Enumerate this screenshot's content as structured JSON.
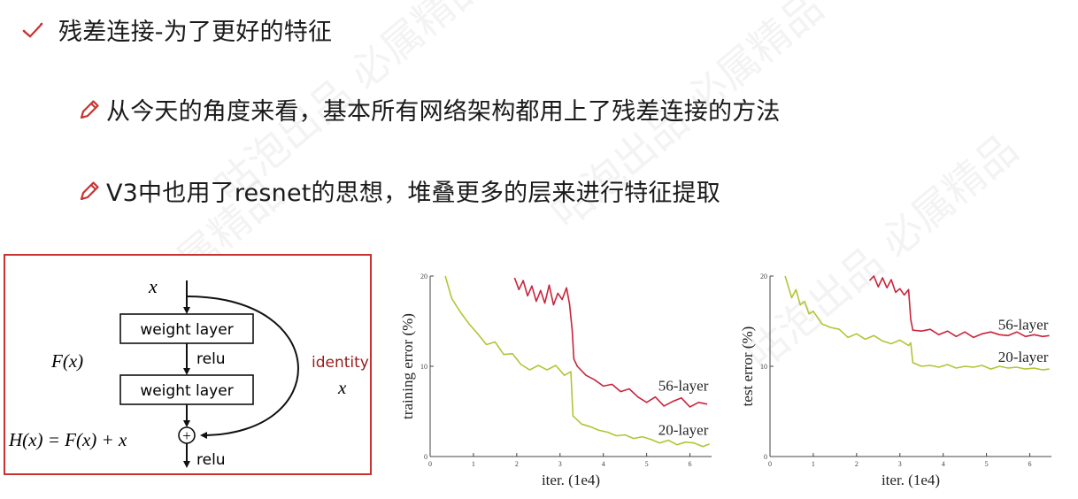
{
  "heading": {
    "text": "残差连接-为了更好的特征"
  },
  "bullets": [
    {
      "text": "从今天的角度来看，基本所有网络架构都用上了残差连接的方法"
    },
    {
      "text": "V3中也用了resnet的思想，堆叠更多的层来进行特征提取"
    }
  ],
  "watermark": {
    "text": "咕泡出品 必属精品"
  },
  "res_block": {
    "input_label": "x",
    "layer1": "weight layer",
    "relu_mid": "relu",
    "layer2": "weight layer",
    "fx_label": "F(x)",
    "identity_label": "identity",
    "identity_x": "x",
    "hx_label": "H(x) = F(x) + x",
    "plus": "+",
    "relu_out": "relu"
  },
  "colors": {
    "accent": "#c8332f",
    "red_line": "#c9243b",
    "green_line": "#b4c436",
    "identity": "#9a1a1a"
  },
  "chart_data": [
    {
      "type": "line",
      "xlabel": "iter. (1e4)",
      "ylabel": "training error (%)",
      "xlim": [
        0,
        6.5
      ],
      "ylim": [
        0,
        20
      ],
      "xticks": [
        0,
        1,
        2,
        3,
        4,
        5,
        6
      ],
      "yticks": [
        0,
        10,
        20
      ],
      "series": [
        {
          "name": "56-layer",
          "x": [
            1.95,
            2.05,
            2.15,
            2.25,
            2.35,
            2.45,
            2.55,
            2.65,
            2.75,
            2.85,
            2.95,
            3.05,
            3.15,
            3.22,
            3.28,
            3.32,
            3.4,
            3.6,
            3.8,
            4.0,
            4.2,
            4.4,
            4.6,
            4.8,
            5.0,
            5.2,
            5.4,
            5.6,
            5.8,
            6.0,
            6.2,
            6.4
          ],
          "y": [
            19.8,
            18.5,
            19.5,
            17.8,
            18.9,
            17.2,
            18.4,
            17.0,
            19.0,
            16.8,
            18.1,
            17.4,
            18.7,
            16.9,
            14.0,
            10.8,
            10.0,
            9.0,
            8.5,
            7.8,
            8.0,
            7.2,
            7.5,
            6.6,
            6.0,
            6.6,
            5.6,
            6.1,
            6.5,
            5.5,
            6.0,
            5.8
          ]
        },
        {
          "name": "20-layer",
          "x": [
            0.35,
            0.5,
            0.7,
            0.9,
            1.1,
            1.3,
            1.5,
            1.7,
            1.9,
            2.1,
            2.3,
            2.5,
            2.7,
            2.9,
            3.1,
            3.25,
            3.3,
            3.5,
            3.7,
            3.9,
            4.1,
            4.3,
            4.5,
            4.7,
            4.9,
            5.1,
            5.3,
            5.5,
            5.7,
            5.9,
            6.1,
            6.3,
            6.45
          ],
          "y": [
            20.0,
            17.5,
            16.0,
            14.7,
            13.6,
            12.4,
            12.7,
            11.3,
            11.4,
            10.2,
            9.6,
            10.1,
            9.6,
            10.1,
            9.0,
            9.4,
            4.5,
            3.6,
            3.3,
            2.9,
            2.7,
            2.3,
            2.4,
            2.0,
            2.2,
            1.9,
            1.5,
            1.8,
            1.3,
            1.6,
            1.5,
            1.1,
            1.4
          ]
        }
      ]
    },
    {
      "type": "line",
      "xlabel": "iter. (1e4)",
      "ylabel": "test error (%)",
      "xlim": [
        0,
        6.5
      ],
      "ylim": [
        0,
        20
      ],
      "xticks": [
        0,
        1,
        2,
        3,
        4,
        5,
        6
      ],
      "yticks": [
        0,
        10,
        20
      ],
      "series": [
        {
          "name": "56-layer",
          "x": [
            2.3,
            2.4,
            2.5,
            2.6,
            2.7,
            2.8,
            2.9,
            3.0,
            3.1,
            3.2,
            3.25,
            3.3,
            3.5,
            3.7,
            3.9,
            4.1,
            4.3,
            4.5,
            4.7,
            4.9,
            5.1,
            5.3,
            5.5,
            5.7,
            5.9,
            6.1,
            6.3,
            6.45
          ],
          "y": [
            19.5,
            20.0,
            18.8,
            19.8,
            18.7,
            19.6,
            18.2,
            18.6,
            17.9,
            18.5,
            15.2,
            14.0,
            13.9,
            14.1,
            13.5,
            13.9,
            13.3,
            13.8,
            13.2,
            13.6,
            13.8,
            13.5,
            13.4,
            13.8,
            13.3,
            13.5,
            13.3,
            13.4
          ]
        },
        {
          "name": "20-layer",
          "x": [
            0.35,
            0.5,
            0.6,
            0.7,
            0.8,
            0.9,
            1.0,
            1.2,
            1.4,
            1.6,
            1.8,
            2.0,
            2.2,
            2.4,
            2.6,
            2.8,
            3.0,
            3.2,
            3.25,
            3.3,
            3.5,
            3.7,
            3.9,
            4.1,
            4.3,
            4.5,
            4.7,
            4.9,
            5.1,
            5.3,
            5.5,
            5.7,
            5.9,
            6.1,
            6.3,
            6.45
          ],
          "y": [
            20.0,
            17.6,
            18.5,
            16.8,
            17.2,
            15.8,
            16.1,
            14.7,
            14.3,
            14.1,
            13.2,
            13.6,
            13.0,
            13.4,
            12.8,
            12.5,
            12.9,
            12.3,
            12.6,
            10.4,
            10.0,
            10.1,
            9.9,
            10.2,
            9.8,
            10.0,
            9.9,
            10.1,
            9.7,
            10.0,
            9.8,
            9.9,
            9.7,
            9.8,
            9.6,
            9.7
          ]
        }
      ]
    }
  ]
}
